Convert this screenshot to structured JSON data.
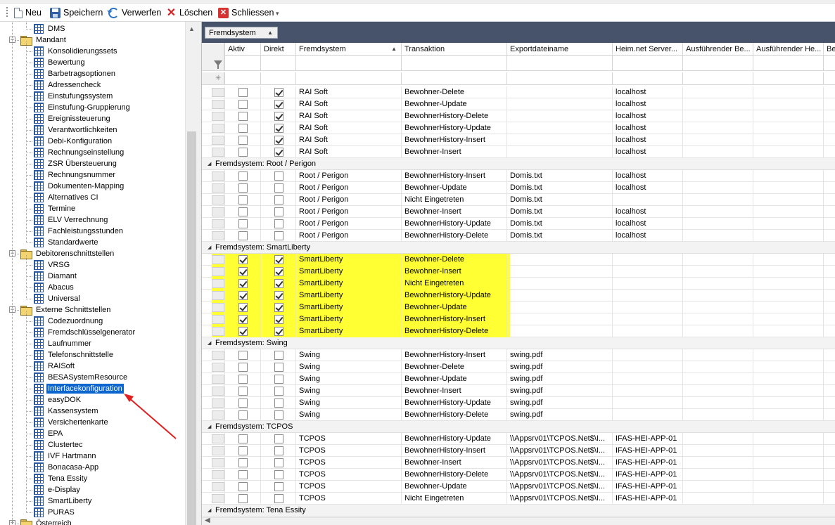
{
  "toolbar": {
    "new_label": "Neu",
    "save_label": "Speichern",
    "discard_label": "Verwerfen",
    "delete_label": "Löschen",
    "close_label": "Schliessen",
    "more_glyph": "▾"
  },
  "tree": {
    "items": [
      {
        "label": "DMS",
        "level": 2,
        "icon": "grid-icon"
      },
      {
        "label": "Mandant",
        "level": 1,
        "icon": "folder-icon",
        "expanded": true
      },
      {
        "label": "Konsolidierungssets",
        "level": 2,
        "icon": "grid-icon"
      },
      {
        "label": "Bewertung",
        "level": 2,
        "icon": "grid-icon"
      },
      {
        "label": "Barbetragsoptionen",
        "level": 2,
        "icon": "grid-icon"
      },
      {
        "label": "Adressencheck",
        "level": 2,
        "icon": "grid-icon"
      },
      {
        "label": "Einstufungssystem",
        "level": 2,
        "icon": "grid-icon"
      },
      {
        "label": "Einstufung-Gruppierung",
        "level": 2,
        "icon": "grid-icon"
      },
      {
        "label": "Ereignissteuerung",
        "level": 2,
        "icon": "grid-icon"
      },
      {
        "label": "Verantwortlichkeiten",
        "level": 2,
        "icon": "grid-icon"
      },
      {
        "label": "Debi-Konfiguration",
        "level": 2,
        "icon": "grid-icon"
      },
      {
        "label": "Rechnungseinstellung",
        "level": 2,
        "icon": "grid-icon"
      },
      {
        "label": "ZSR Übersteuerung",
        "level": 2,
        "icon": "grid-icon"
      },
      {
        "label": "Rechnungsnummer",
        "level": 2,
        "icon": "grid-icon"
      },
      {
        "label": "Dokumenten-Mapping",
        "level": 2,
        "icon": "grid-icon"
      },
      {
        "label": "Alternatives CI",
        "level": 2,
        "icon": "grid-icon"
      },
      {
        "label": "Termine",
        "level": 2,
        "icon": "grid-icon"
      },
      {
        "label": "ELV Verrechnung",
        "level": 2,
        "icon": "grid-icon"
      },
      {
        "label": "Fachleistungsstunden",
        "level": 2,
        "icon": "grid-icon"
      },
      {
        "label": "Standardwerte",
        "level": 2,
        "icon": "grid-icon"
      },
      {
        "label": "Debitorenschnittstellen",
        "level": 1,
        "icon": "folder-icon",
        "expanded": true
      },
      {
        "label": "VRSG",
        "level": 2,
        "icon": "grid-icon"
      },
      {
        "label": "Diamant",
        "level": 2,
        "icon": "grid-icon"
      },
      {
        "label": "Abacus",
        "level": 2,
        "icon": "grid-icon"
      },
      {
        "label": "Universal",
        "level": 2,
        "icon": "grid-icon"
      },
      {
        "label": "Externe Schnittstellen",
        "level": 1,
        "icon": "folder-icon",
        "expanded": true
      },
      {
        "label": "Codezuordnung",
        "level": 2,
        "icon": "grid-icon"
      },
      {
        "label": "Fremdschlüsselgenerator",
        "level": 2,
        "icon": "grid-icon"
      },
      {
        "label": "Laufnummer",
        "level": 2,
        "icon": "grid-icon"
      },
      {
        "label": "Telefonschnittstelle",
        "level": 2,
        "icon": "grid-icon"
      },
      {
        "label": "RAISoft",
        "level": 2,
        "icon": "grid-icon"
      },
      {
        "label": "BESASystemResource",
        "level": 2,
        "icon": "grid-icon"
      },
      {
        "label": "Interfacekonfiguration",
        "level": 2,
        "icon": "grid-icon",
        "selected": true
      },
      {
        "label": "easyDOK",
        "level": 2,
        "icon": "grid-icon"
      },
      {
        "label": "Kassensystem",
        "level": 2,
        "icon": "grid-icon"
      },
      {
        "label": "Versichertenkarte",
        "level": 2,
        "icon": "grid-icon"
      },
      {
        "label": "EPA",
        "level": 2,
        "icon": "grid-icon"
      },
      {
        "label": "Clustertec",
        "level": 2,
        "icon": "grid-icon"
      },
      {
        "label": "IVF Hartmann",
        "level": 2,
        "icon": "grid-icon"
      },
      {
        "label": "Bonacasa-App",
        "level": 2,
        "icon": "grid-icon"
      },
      {
        "label": "Tena Essity",
        "level": 2,
        "icon": "grid-icon"
      },
      {
        "label": "e-Display",
        "level": 2,
        "icon": "grid-icon"
      },
      {
        "label": "SmartLiberty",
        "level": 2,
        "icon": "grid-icon"
      },
      {
        "label": "PURAS",
        "level": 2,
        "icon": "grid-icon"
      },
      {
        "label": "Österreich",
        "level": 1,
        "icon": "folder-icon",
        "expanded": false
      }
    ]
  },
  "grid": {
    "group_chip_label": "Fremdsystem",
    "columns": [
      {
        "key": "aktiv",
        "label": "Aktiv"
      },
      {
        "key": "direkt",
        "label": "Direkt"
      },
      {
        "key": "fremdsystem",
        "label": "Fremdsystem",
        "sorted": true
      },
      {
        "key": "transaktion",
        "label": "Transaktion"
      },
      {
        "key": "exportdatei",
        "label": "Exportdateiname"
      },
      {
        "key": "server",
        "label": "Heim.net Server..."
      },
      {
        "key": "ausf1",
        "label": "Ausführender Be..."
      },
      {
        "key": "ausf2",
        "label": "Ausführender He..."
      },
      {
        "key": "b",
        "label": "Be"
      }
    ],
    "group_prefix": "Fremdsystem:",
    "sections": [
      {
        "name": "",
        "rows": [
          {
            "aktiv": false,
            "direkt": true,
            "fremdsystem": "RAI Soft",
            "transaktion": "Bewohner-Delete",
            "exportdatei": "",
            "server": "localhost"
          },
          {
            "aktiv": false,
            "direkt": true,
            "fremdsystem": "RAI Soft",
            "transaktion": "Bewohner-Update",
            "exportdatei": "",
            "server": "localhost"
          },
          {
            "aktiv": false,
            "direkt": true,
            "fremdsystem": "RAI Soft",
            "transaktion": "BewohnerHistory-Delete",
            "exportdatei": "",
            "server": "localhost"
          },
          {
            "aktiv": false,
            "direkt": true,
            "fremdsystem": "RAI Soft",
            "transaktion": "BewohnerHistory-Update",
            "exportdatei": "",
            "server": "localhost"
          },
          {
            "aktiv": false,
            "direkt": true,
            "fremdsystem": "RAI Soft",
            "transaktion": "BewohnerHistory-Insert",
            "exportdatei": "",
            "server": "localhost"
          },
          {
            "aktiv": false,
            "direkt": true,
            "fremdsystem": "RAI Soft",
            "transaktion": "Bewohner-Insert",
            "exportdatei": "",
            "server": "localhost"
          }
        ]
      },
      {
        "name": "Root / Perigon",
        "rows": [
          {
            "aktiv": false,
            "direkt": false,
            "fremdsystem": "Root / Perigon",
            "transaktion": "BewohnerHistory-Insert",
            "exportdatei": "Domis.txt",
            "server": "localhost"
          },
          {
            "aktiv": false,
            "direkt": false,
            "fremdsystem": "Root / Perigon",
            "transaktion": "Bewohner-Update",
            "exportdatei": "Domis.txt",
            "server": "localhost"
          },
          {
            "aktiv": false,
            "direkt": false,
            "fremdsystem": "Root / Perigon",
            "transaktion": "Nicht Eingetreten",
            "exportdatei": "Domis.txt",
            "server": ""
          },
          {
            "aktiv": false,
            "direkt": false,
            "fremdsystem": "Root / Perigon",
            "transaktion": "Bewohner-Insert",
            "exportdatei": "Domis.txt",
            "server": "localhost"
          },
          {
            "aktiv": false,
            "direkt": false,
            "fremdsystem": "Root / Perigon",
            "transaktion": "BewohnerHistory-Update",
            "exportdatei": "Domis.txt",
            "server": "localhost"
          },
          {
            "aktiv": false,
            "direkt": false,
            "fremdsystem": "Root / Perigon",
            "transaktion": "BewohnerHistory-Delete",
            "exportdatei": "Domis.txt",
            "server": "localhost"
          }
        ]
      },
      {
        "name": "SmartLiberty",
        "highlighted": true,
        "rows": [
          {
            "aktiv": true,
            "direkt": true,
            "fremdsystem": "SmartLiberty",
            "transaktion": "Bewohner-Delete",
            "exportdatei": "",
            "server": ""
          },
          {
            "aktiv": true,
            "direkt": true,
            "fremdsystem": "SmartLiberty",
            "transaktion": "Bewohner-Insert",
            "exportdatei": "",
            "server": ""
          },
          {
            "aktiv": true,
            "direkt": true,
            "fremdsystem": "SmartLiberty",
            "transaktion": "Nicht Eingetreten",
            "exportdatei": "",
            "server": ""
          },
          {
            "aktiv": true,
            "direkt": true,
            "fremdsystem": "SmartLiberty",
            "transaktion": "BewohnerHistory-Update",
            "exportdatei": "",
            "server": ""
          },
          {
            "aktiv": true,
            "direkt": true,
            "fremdsystem": "SmartLiberty",
            "transaktion": "Bewohner-Update",
            "exportdatei": "",
            "server": ""
          },
          {
            "aktiv": true,
            "direkt": true,
            "fremdsystem": "SmartLiberty",
            "transaktion": "BewohnerHistory-Insert",
            "exportdatei": "",
            "server": ""
          },
          {
            "aktiv": true,
            "direkt": true,
            "fremdsystem": "SmartLiberty",
            "transaktion": "BewohnerHistory-Delete",
            "exportdatei": "",
            "server": ""
          }
        ]
      },
      {
        "name": "Swing",
        "rows": [
          {
            "aktiv": false,
            "direkt": false,
            "fremdsystem": "Swing",
            "transaktion": "BewohnerHistory-Insert",
            "exportdatei": "swing.pdf",
            "server": ""
          },
          {
            "aktiv": false,
            "direkt": false,
            "fremdsystem": "Swing",
            "transaktion": "Bewohner-Delete",
            "exportdatei": "swing.pdf",
            "server": ""
          },
          {
            "aktiv": false,
            "direkt": false,
            "fremdsystem": "Swing",
            "transaktion": "Bewohner-Update",
            "exportdatei": "swing.pdf",
            "server": ""
          },
          {
            "aktiv": false,
            "direkt": false,
            "fremdsystem": "Swing",
            "transaktion": "Bewohner-Insert",
            "exportdatei": "swing.pdf",
            "server": ""
          },
          {
            "aktiv": false,
            "direkt": false,
            "fremdsystem": "Swing",
            "transaktion": "BewohnerHistory-Update",
            "exportdatei": "swing.pdf",
            "server": ""
          },
          {
            "aktiv": false,
            "direkt": false,
            "fremdsystem": "Swing",
            "transaktion": "BewohnerHistory-Delete",
            "exportdatei": "swing.pdf",
            "server": ""
          }
        ]
      },
      {
        "name": "TCPOS",
        "rows": [
          {
            "aktiv": false,
            "direkt": false,
            "fremdsystem": "TCPOS",
            "transaktion": "BewohnerHistory-Update",
            "exportdatei": "\\\\Appsrv01\\TCPOS.Net$\\I...",
            "server": "IFAS-HEI-APP-01"
          },
          {
            "aktiv": false,
            "direkt": false,
            "fremdsystem": "TCPOS",
            "transaktion": "BewohnerHistory-Insert",
            "exportdatei": "\\\\Appsrv01\\TCPOS.Net$\\I...",
            "server": "IFAS-HEI-APP-01"
          },
          {
            "aktiv": false,
            "direkt": false,
            "fremdsystem": "TCPOS",
            "transaktion": "Bewohner-Insert",
            "exportdatei": "\\\\Appsrv01\\TCPOS.Net$\\I...",
            "server": "IFAS-HEI-APP-01"
          },
          {
            "aktiv": false,
            "direkt": false,
            "fremdsystem": "TCPOS",
            "transaktion": "BewohnerHistory-Delete",
            "exportdatei": "\\\\Appsrv01\\TCPOS.Net$\\I...",
            "server": "IFAS-HEI-APP-01"
          },
          {
            "aktiv": false,
            "direkt": false,
            "fremdsystem": "TCPOS",
            "transaktion": "Bewohner-Update",
            "exportdatei": "\\\\Appsrv01\\TCPOS.Net$\\I...",
            "server": "IFAS-HEI-APP-01"
          },
          {
            "aktiv": false,
            "direkt": false,
            "fremdsystem": "TCPOS",
            "transaktion": "Nicht Eingetreten",
            "exportdatei": "\\\\Appsrv01\\TCPOS.Net$\\I...",
            "server": "IFAS-HEI-APP-01"
          }
        ]
      },
      {
        "name": "Tena Essity",
        "rows": []
      }
    ]
  },
  "colors": {
    "highlight": "#ffff33",
    "selection": "#0b66d0",
    "group_bar": "#46536a",
    "annotation_arrow": "#e02020"
  }
}
